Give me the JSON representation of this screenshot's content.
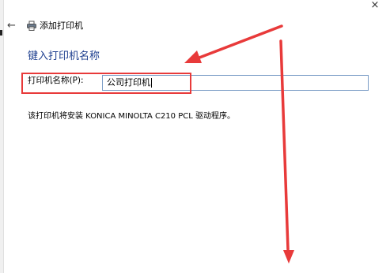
{
  "window": {
    "title": "添加打印机",
    "close_symbol": "×",
    "back_symbol": "←"
  },
  "page": {
    "heading": "键入打印机名称"
  },
  "printer_name": {
    "label": "打印机名称(P):",
    "value": "公司打印机"
  },
  "info": {
    "driver_text": "该打印机将安装 KONICA MINOLTA C210 PCL 驱动程序。"
  },
  "colors": {
    "heading": "#1e3f8f",
    "annotation_red": "#e83a3a",
    "input_border": "#7a9cc6"
  },
  "icons": {
    "back": "back-arrow-icon",
    "printer": "printer-icon",
    "close": "close-icon"
  }
}
